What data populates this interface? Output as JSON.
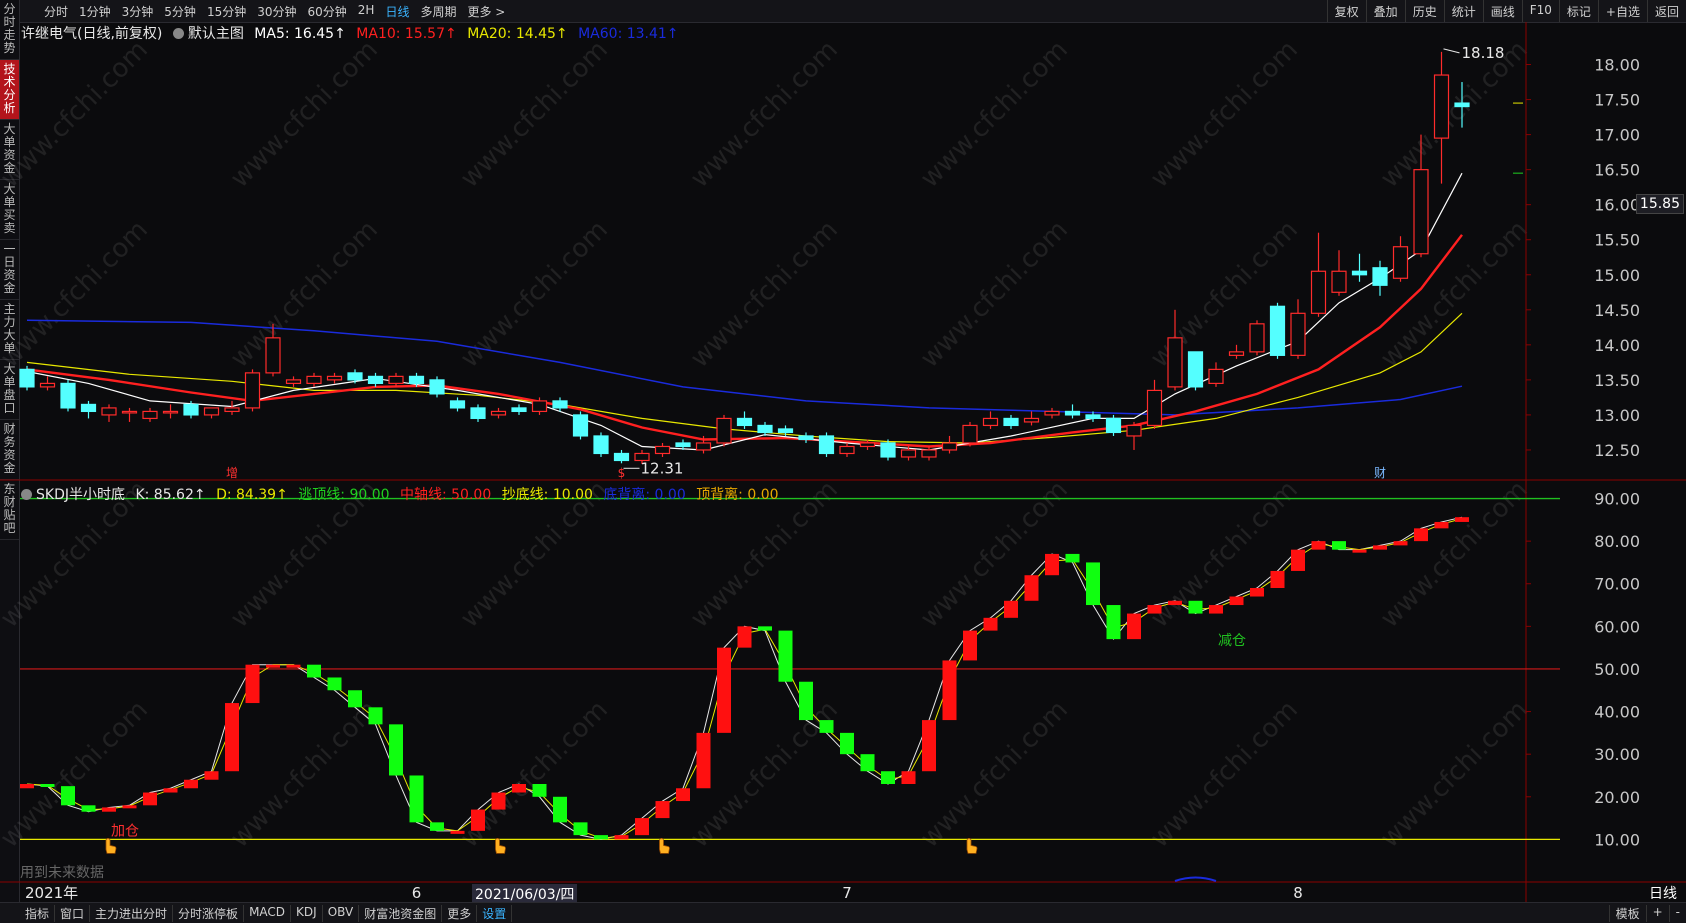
{
  "topbar": {
    "periods": [
      "分时",
      "1分钟",
      "3分钟",
      "5分钟",
      "15分钟",
      "30分钟",
      "60分钟",
      "2H",
      "日线",
      "多周期",
      "更多 >"
    ],
    "active_period": "日线",
    "tools": [
      "复权",
      "叠加",
      "历史",
      "统计",
      "画线",
      "F10",
      "标记",
      "+自选",
      "返回"
    ]
  },
  "sidebar": {
    "tabs": [
      "分时走势",
      "技术分析",
      "大单资金",
      "大单买卖",
      "一日资金",
      "主力大单",
      "大单盘口",
      "财务资金",
      "东财贴吧"
    ],
    "active": "技术分析"
  },
  "main_legend": {
    "title": "许继电气(日线,前复权)",
    "indicator": "默认主图",
    "ma5": "MA5: 16.45↑",
    "ma10": "MA10: 15.57↑",
    "ma20": "MA20: 14.45↑",
    "ma60": "MA60: 13.41↑"
  },
  "sub_legend": {
    "name": "SKDJ半小时底",
    "k": "K: 85.62↑",
    "d": "D: 84.39↑",
    "top_line": "逃顶线: 90.00",
    "mid_line": "中轴线: 50.00",
    "bottom_line": "抄底线: 10.00",
    "bottom_div": "底背离: 0.00",
    "top_div": "顶背离: 0.00"
  },
  "annotations": {
    "high": "18.18",
    "low": "12.31",
    "price_box": "15.85",
    "mark_zeng": "增",
    "mark_s": "$",
    "mark_cai": "财",
    "buy_label": "加仓",
    "reduce_label": "减仓",
    "future_data": "用到未来数据",
    "watermark": "www.cfchi.com"
  },
  "time_axis": {
    "labels": [
      "2021年",
      "6",
      "7",
      "8"
    ],
    "cursor_date": "2021/06/03/四"
  },
  "bottombar": {
    "tabs": [
      "指标",
      "窗口",
      "主力进出分时",
      "分时涨停板",
      "MACD",
      "KDJ",
      "OBV",
      "财富池资金图",
      "更多",
      "设置"
    ],
    "highlight": "设置",
    "right": [
      "模板",
      "+",
      "-"
    ],
    "period_label": "日线"
  },
  "colors": {
    "up": "#ff2b2b",
    "down": "#54ffff",
    "ma5": "#ffffff",
    "ma10": "#ff2020",
    "ma20": "#e8e800",
    "ma60": "#1a2bdc",
    "k_up": "#ff1010",
    "k_down": "#10ff10",
    "axis_text": "#c8c8c8",
    "grid_line": "#8b0000"
  },
  "chart_data": [
    {
      "type": "candlestick",
      "title": "许继电气(日线,前复权)",
      "y_ticks": [
        18.0,
        17.5,
        17.0,
        16.5,
        16.0,
        15.5,
        15.0,
        14.5,
        14.0,
        13.5,
        13.0,
        12.5
      ],
      "ylim": [
        12.1,
        18.35
      ],
      "candles": [
        [
          13.65,
          13.4,
          13.7,
          13.35
        ],
        [
          13.4,
          13.45,
          13.55,
          13.35
        ],
        [
          13.45,
          13.1,
          13.5,
          13.05
        ],
        [
          13.15,
          13.05,
          13.2,
          12.95
        ],
        [
          13.0,
          13.1,
          13.15,
          12.9
        ],
        [
          13.05,
          13.05,
          13.1,
          12.9
        ],
        [
          12.95,
          13.05,
          13.1,
          12.9
        ],
        [
          13.05,
          13.05,
          13.15,
          12.95
        ],
        [
          13.15,
          13.0,
          13.2,
          12.95
        ],
        [
          13.0,
          13.1,
          13.1,
          12.95
        ],
        [
          13.05,
          13.1,
          13.2,
          13.0
        ],
        [
          13.1,
          13.6,
          13.65,
          13.05
        ],
        [
          13.6,
          14.1,
          14.3,
          13.55
        ],
        [
          13.45,
          13.5,
          13.55,
          13.4
        ],
        [
          13.45,
          13.55,
          13.6,
          13.4
        ],
        [
          13.5,
          13.55,
          13.6,
          13.45
        ],
        [
          13.6,
          13.5,
          13.65,
          13.45
        ],
        [
          13.55,
          13.45,
          13.6,
          13.4
        ],
        [
          13.45,
          13.55,
          13.6,
          13.4
        ],
        [
          13.55,
          13.45,
          13.6,
          13.4
        ],
        [
          13.5,
          13.3,
          13.55,
          13.25
        ],
        [
          13.2,
          13.1,
          13.25,
          13.05
        ],
        [
          13.1,
          12.95,
          13.15,
          12.9
        ],
        [
          13.0,
          13.05,
          13.1,
          12.95
        ],
        [
          13.1,
          13.05,
          13.15,
          13.0
        ],
        [
          13.05,
          13.2,
          13.25,
          13.0
        ],
        [
          13.2,
          13.1,
          13.25,
          13.05
        ],
        [
          13.0,
          12.7,
          13.05,
          12.65
        ],
        [
          12.7,
          12.45,
          12.75,
          12.4
        ],
        [
          12.45,
          12.35,
          12.5,
          12.31
        ],
        [
          12.35,
          12.45,
          12.5,
          12.3
        ],
        [
          12.45,
          12.55,
          12.6,
          12.4
        ],
        [
          12.6,
          12.55,
          12.65,
          12.5
        ],
        [
          12.5,
          12.6,
          12.7,
          12.45
        ],
        [
          12.6,
          12.95,
          13.0,
          12.55
        ],
        [
          12.95,
          12.85,
          13.05,
          12.8
        ],
        [
          12.85,
          12.75,
          12.9,
          12.7
        ],
        [
          12.8,
          12.75,
          12.85,
          12.7
        ],
        [
          12.7,
          12.65,
          12.75,
          12.6
        ],
        [
          12.7,
          12.45,
          12.75,
          12.4
        ],
        [
          12.45,
          12.55,
          12.6,
          12.4
        ],
        [
          12.55,
          12.6,
          12.65,
          12.5
        ],
        [
          12.6,
          12.4,
          12.65,
          12.35
        ],
        [
          12.4,
          12.5,
          12.55,
          12.35
        ],
        [
          12.4,
          12.5,
          12.55,
          12.35
        ],
        [
          12.5,
          12.6,
          12.7,
          12.45
        ],
        [
          12.6,
          12.85,
          12.9,
          12.55
        ],
        [
          12.85,
          12.95,
          13.05,
          12.8
        ],
        [
          12.95,
          12.85,
          13.0,
          12.8
        ],
        [
          12.9,
          12.95,
          13.05,
          12.85
        ],
        [
          13.0,
          13.05,
          13.1,
          12.95
        ],
        [
          13.05,
          13.0,
          13.15,
          12.95
        ],
        [
          13.0,
          12.95,
          13.05,
          12.9
        ],
        [
          12.95,
          12.75,
          13.0,
          12.7
        ],
        [
          12.7,
          12.85,
          12.9,
          12.5
        ],
        [
          12.85,
          13.35,
          13.5,
          12.8
        ],
        [
          13.4,
          14.1,
          14.5,
          13.35
        ],
        [
          13.9,
          13.4,
          13.9,
          13.35
        ],
        [
          13.45,
          13.65,
          13.75,
          13.4
        ],
        [
          13.85,
          13.9,
          14.0,
          13.8
        ],
        [
          13.9,
          14.3,
          14.35,
          13.85
        ],
        [
          14.55,
          13.85,
          14.6,
          13.8
        ],
        [
          13.85,
          14.45,
          14.65,
          13.8
        ],
        [
          14.45,
          15.05,
          15.6,
          14.4
        ],
        [
          14.75,
          15.05,
          15.35,
          14.7
        ],
        [
          15.05,
          15.0,
          15.3,
          14.9
        ],
        [
          15.1,
          14.85,
          15.2,
          14.7
        ],
        [
          14.95,
          15.4,
          15.55,
          14.9
        ],
        [
          15.3,
          16.5,
          17.0,
          15.25
        ],
        [
          16.95,
          17.85,
          18.18,
          16.3
        ],
        [
          17.45,
          17.4,
          17.75,
          17.1
        ]
      ],
      "ma5": [
        [
          0,
          13.62
        ],
        [
          3,
          13.45
        ],
        [
          6,
          13.2
        ],
        [
          10,
          13.12
        ],
        [
          13,
          13.35
        ],
        [
          17,
          13.52
        ],
        [
          21,
          13.35
        ],
        [
          25,
          13.15
        ],
        [
          28,
          12.85
        ],
        [
          30,
          12.55
        ],
        [
          33,
          12.5
        ],
        [
          36,
          12.72
        ],
        [
          40,
          12.6
        ],
        [
          44,
          12.5
        ],
        [
          48,
          12.7
        ],
        [
          52,
          12.95
        ],
        [
          54,
          12.95
        ],
        [
          56,
          13.3
        ],
        [
          59,
          13.7
        ],
        [
          62,
          14.05
        ],
        [
          64,
          14.6
        ],
        [
          66,
          14.95
        ],
        [
          68,
          15.35
        ],
        [
          70,
          16.45
        ]
      ],
      "ma10": [
        [
          0,
          13.65
        ],
        [
          4,
          13.5
        ],
        [
          8,
          13.32
        ],
        [
          11,
          13.2
        ],
        [
          14,
          13.3
        ],
        [
          17,
          13.4
        ],
        [
          20,
          13.42
        ],
        [
          23,
          13.3
        ],
        [
          27,
          13.08
        ],
        [
          30,
          12.82
        ],
        [
          33,
          12.65
        ],
        [
          37,
          12.67
        ],
        [
          40,
          12.62
        ],
        [
          44,
          12.55
        ],
        [
          47,
          12.6
        ],
        [
          51,
          12.75
        ],
        [
          54,
          12.85
        ],
        [
          57,
          13.05
        ],
        [
          60,
          13.3
        ],
        [
          63,
          13.65
        ],
        [
          66,
          14.25
        ],
        [
          68,
          14.8
        ],
        [
          70,
          15.57
        ]
      ],
      "ma20": [
        [
          0,
          13.75
        ],
        [
          5,
          13.58
        ],
        [
          10,
          13.48
        ],
        [
          14,
          13.35
        ],
        [
          18,
          13.35
        ],
        [
          22,
          13.28
        ],
        [
          26,
          13.15
        ],
        [
          30,
          12.95
        ],
        [
          34,
          12.8
        ],
        [
          38,
          12.7
        ],
        [
          42,
          12.62
        ],
        [
          46,
          12.6
        ],
        [
          50,
          12.68
        ],
        [
          54,
          12.78
        ],
        [
          58,
          12.95
        ],
        [
          62,
          13.25
        ],
        [
          66,
          13.6
        ],
        [
          68,
          13.9
        ],
        [
          70,
          14.45
        ]
      ],
      "ma60": [
        [
          0,
          14.35
        ],
        [
          8,
          14.32
        ],
        [
          14,
          14.2
        ],
        [
          20,
          14.05
        ],
        [
          26,
          13.75
        ],
        [
          32,
          13.4
        ],
        [
          38,
          13.2
        ],
        [
          44,
          13.1
        ],
        [
          50,
          13.05
        ],
        [
          56,
          13.0
        ],
        [
          62,
          13.1
        ],
        [
          67,
          13.22
        ],
        [
          70,
          13.41
        ]
      ]
    },
    {
      "type": "candlestick",
      "title": "SKDJ半小时底",
      "y_ticks": [
        90,
        80,
        70,
        60,
        50,
        40,
        30,
        20,
        10
      ],
      "ylim": [
        0,
        92
      ],
      "reference_lines": {
        "逃顶线": 90,
        "中轴线": 50,
        "抄底线": 10
      },
      "k_line": [
        23,
        22.5,
        18,
        16.5,
        17.5,
        18,
        21,
        22,
        24,
        26,
        42,
        51,
        51,
        51,
        48,
        45,
        41,
        37,
        25,
        14,
        12,
        12,
        17,
        21,
        23,
        20,
        14,
        11,
        10,
        11,
        15,
        19,
        22,
        35,
        55,
        60,
        59,
        47,
        38,
        35,
        30,
        26,
        23,
        26,
        38,
        52,
        59,
        62,
        66,
        72,
        77,
        75,
        65,
        57,
        63,
        65,
        66,
        63,
        65,
        67,
        69,
        73,
        78,
        80,
        78,
        78,
        79,
        80,
        83,
        84.5,
        85.62
      ]
    }
  ]
}
